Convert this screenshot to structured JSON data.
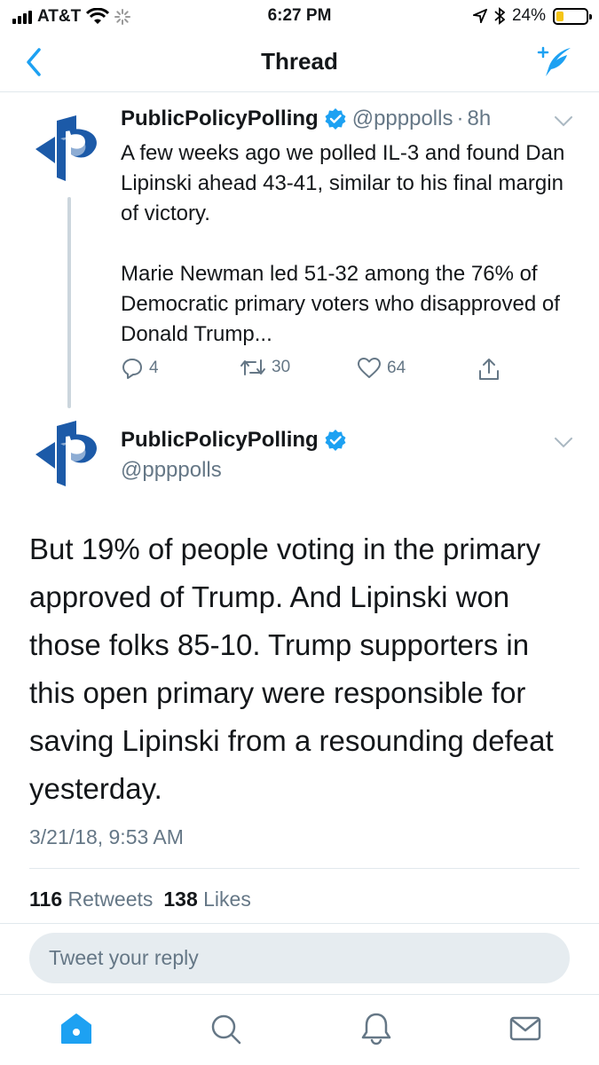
{
  "status_bar": {
    "carrier": "AT&T",
    "time": "6:27 PM",
    "battery_percent": "24%",
    "battery_level": 0.24
  },
  "nav": {
    "title": "Thread",
    "back_icon": "chevron-left-icon",
    "compose_icon": "compose-tweet-icon"
  },
  "colors": {
    "accent": "#1da1f2",
    "text_primary": "#14171a",
    "text_secondary": "#657786",
    "divider": "#e1e8ed",
    "reply_background": "#e6ecf0",
    "battery": "#f5c518"
  },
  "tweet1": {
    "name": "PublicPolicyPolling",
    "handle": "@ppppolls",
    "separator": "·",
    "age": "8h",
    "paragraphs": [
      "A few weeks ago we polled IL-3 and found Dan Lipinski ahead 43-41, similar to his final margin of victory.",
      "Marie Newman led 51-32 among the 76% of Democratic primary voters who disapproved of Donald Trump..."
    ],
    "replies": "4",
    "retweets": "30",
    "likes": "64"
  },
  "tweet2": {
    "name": "PublicPolicyPolling",
    "handle": "@ppppolls",
    "text": "But 19% of people voting in the primary approved of Trump. And Lipinski won those folks 85-10. Trump supporters in this open primary were responsible for saving Lipinski from a resounding defeat yesterday.",
    "timestamp": "3/21/18, 9:53 AM",
    "retweet_count": "116",
    "retweet_label": "Retweets",
    "like_count": "138",
    "like_label": "Likes"
  },
  "reply": {
    "placeholder": "Tweet your reply"
  },
  "tab_bar": {
    "items": [
      "home-icon",
      "search-icon",
      "notifications-icon",
      "messages-icon"
    ],
    "active": "home-icon"
  }
}
